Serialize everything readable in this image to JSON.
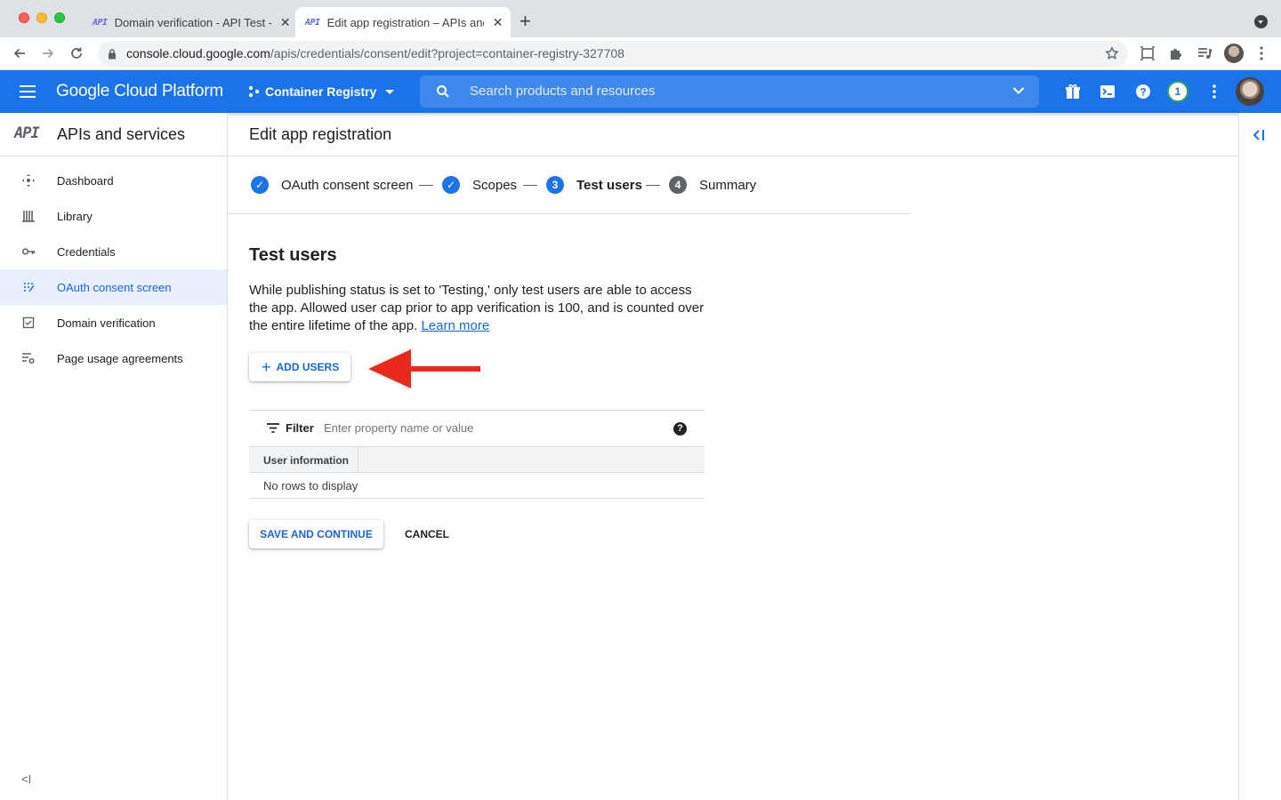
{
  "browser": {
    "tabs": [
      {
        "label": "Domain verification - API Test -",
        "favicon": "API"
      },
      {
        "label": "Edit app registration – APIs and",
        "favicon": "API"
      }
    ],
    "url_host": "console.cloud.google.com",
    "url_path": "/apis/credentials/consent/edit?project=container-registry-327708"
  },
  "header": {
    "product_name": "Google Cloud Platform",
    "project_name": "Container Registry",
    "search_placeholder": "Search products and resources",
    "notification_count": "1",
    "brand_color": "#1a73e8"
  },
  "sidebar": {
    "logo": "API",
    "title": "APIs and services",
    "items": [
      {
        "label": "Dashboard",
        "icon": "dashboard-icon",
        "active": false
      },
      {
        "label": "Library",
        "icon": "library-icon",
        "active": false
      },
      {
        "label": "Credentials",
        "icon": "key-icon",
        "active": false
      },
      {
        "label": "OAuth consent screen",
        "icon": "consent-grid-icon",
        "active": true
      },
      {
        "label": "Domain verification",
        "icon": "checkbox-icon",
        "active": false
      },
      {
        "label": "Page usage agreements",
        "icon": "settings-list-icon",
        "active": false
      }
    ],
    "collapse_label": "<I"
  },
  "main": {
    "page_title": "Edit app registration",
    "steps": [
      {
        "label": "OAuth consent screen",
        "state": "done",
        "marker": "✓"
      },
      {
        "label": "Scopes",
        "state": "done",
        "marker": "✓"
      },
      {
        "label": "Test users",
        "state": "current",
        "marker": "3"
      },
      {
        "label": "Summary",
        "state": "todo",
        "marker": "4"
      }
    ],
    "section_title": "Test users",
    "description": "While publishing status is set to 'Testing,' only test users are able to access the app. Allowed user cap prior to app verification is 100, and is counted over the entire lifetime of the app.",
    "learn_more": "Learn more",
    "add_users_label": "ADD USERS",
    "filter_label": "Filter",
    "filter_placeholder": "Enter property name or value",
    "table_header": "User information",
    "empty_text": "No rows to display",
    "save_label": "SAVE AND CONTINUE",
    "cancel_label": "CANCEL",
    "annotation_color": "#e8291c"
  }
}
